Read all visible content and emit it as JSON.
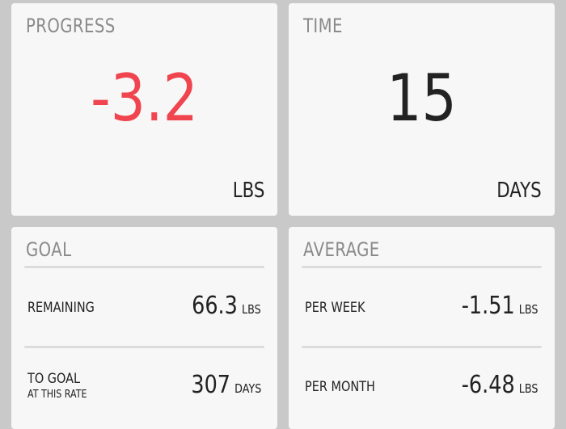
{
  "colors": {
    "negative": "#f0454f",
    "neutral": "#222222"
  },
  "progress": {
    "title": "PROGRESS",
    "value": "-3.2",
    "unit": "LBS"
  },
  "time": {
    "title": "TIME",
    "value": "15",
    "unit": "DAYS"
  },
  "goal": {
    "title": "GOAL",
    "rows": [
      {
        "label": "REMAINING",
        "sublabel": "",
        "value": "66.3",
        "unit": "LBS"
      },
      {
        "label": "TO GOAL",
        "sublabel": "AT THIS RATE",
        "value": "307",
        "unit": "DAYS"
      }
    ]
  },
  "average": {
    "title": "AVERAGE",
    "rows": [
      {
        "label": "PER WEEK",
        "value": "-1.51",
        "unit": "LBS"
      },
      {
        "label": "PER MONTH",
        "value": "-6.48",
        "unit": "LBS"
      }
    ]
  }
}
